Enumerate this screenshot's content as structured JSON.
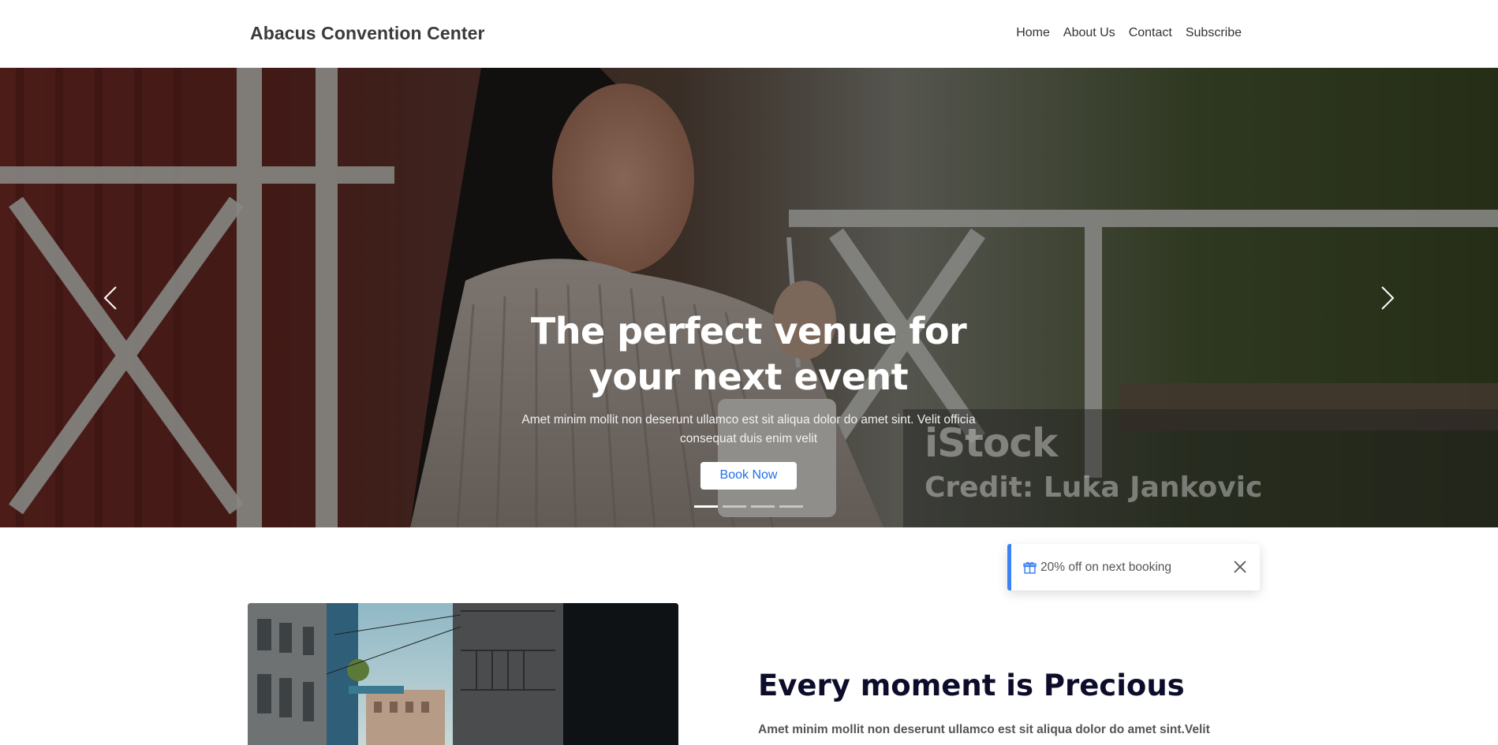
{
  "header": {
    "brand": "Abacus Convention Center",
    "nav": [
      "Home",
      "About Us",
      "Contact",
      "Subscribe"
    ]
  },
  "hero": {
    "title": "The perfect venue for your next event",
    "text": "Amet minim mollit non deserunt ullamco est sit aliqua dolor do amet sint. Velit officia consequat duis enim velit",
    "button": "Book Now",
    "slide_count": 4,
    "active_slide": 1,
    "watermark": {
      "logo": "iStock",
      "credit": "Credit: Luka Jankovic"
    },
    "prev_icon": "chevron-left-icon",
    "next_icon": "chevron-right-icon"
  },
  "toast": {
    "icon": "gift-icon",
    "text": "20% off on next booking",
    "close_icon": "close-icon",
    "accent": "#3b82f6"
  },
  "feature": {
    "title": "Every moment is Precious",
    "text": "Amet minim mollit non deserunt ullamco est sit aliqua dolor do amet sint.Velit"
  },
  "colors": {
    "brand_text": "#3a3a3a",
    "button_text": "#1f6feb",
    "heading": "#0d0d2b"
  }
}
